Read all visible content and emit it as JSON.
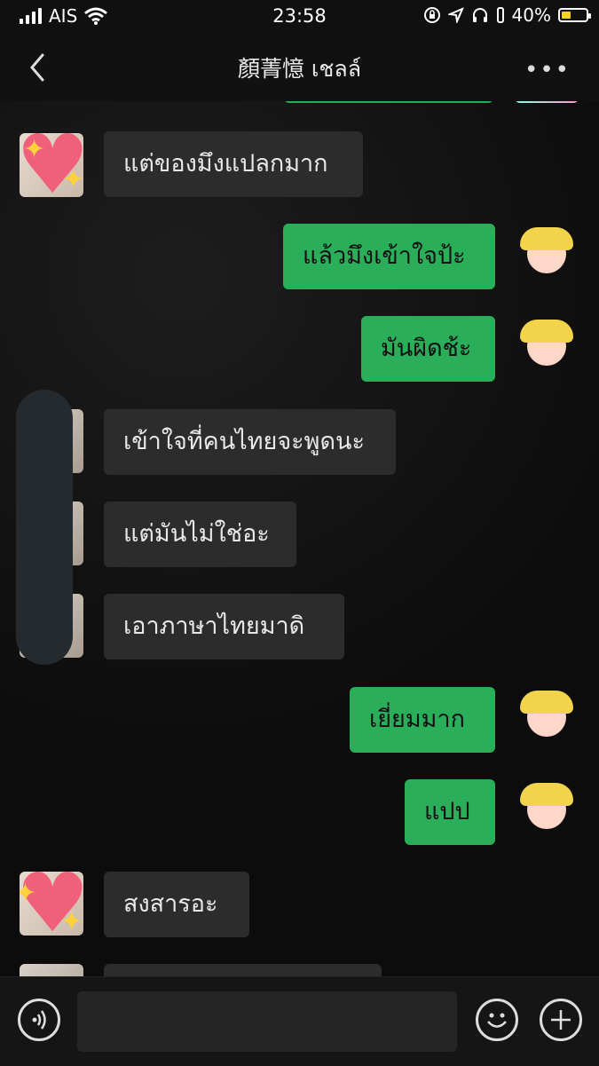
{
  "status_bar": {
    "carrier": "AIS",
    "time": "23:58",
    "battery_percent": "40%",
    "battery_level": 0.4,
    "icons": [
      "signal-icon",
      "wifi-icon",
      "rotation-lock-icon",
      "location-icon",
      "headphones-icon",
      "battery-icon"
    ]
  },
  "header": {
    "title": "顏菁憶 เชลล์",
    "back_icon": "chevron-left-icon",
    "more_label": "•••"
  },
  "messages": [
    {
      "dir": "in",
      "text": "แต่ของมึงแปลกมาก",
      "avatar": "heart-sticker"
    },
    {
      "dir": "out",
      "text": "แล้วมึงเข้าใจป้ะ",
      "avatar": "cartoon-girl"
    },
    {
      "dir": "out",
      "text": "มันผิดช้ะ",
      "avatar": "cartoon-girl"
    },
    {
      "dir": "in",
      "text": "เข้าใจที่คนไทยจะพูดนะ",
      "avatar": "photo"
    },
    {
      "dir": "in",
      "text": "แต่มันไม่ใช่อะ",
      "avatar": "photo"
    },
    {
      "dir": "in",
      "text": "เอาภาษาไทยมาดิ",
      "avatar": "photo"
    },
    {
      "dir": "out",
      "text": "เยี่ยมมาก",
      "avatar": "cartoon-girl"
    },
    {
      "dir": "out",
      "text": "แปป",
      "avatar": "cartoon-girl"
    },
    {
      "dir": "in",
      "text": "สงสารอะ",
      "avatar": "heart-sticker"
    }
  ],
  "input_bar": {
    "voice_icon": "voice-icon",
    "emoji_icon": "emoji-icon",
    "plus_icon": "plus-icon",
    "placeholder": ""
  }
}
